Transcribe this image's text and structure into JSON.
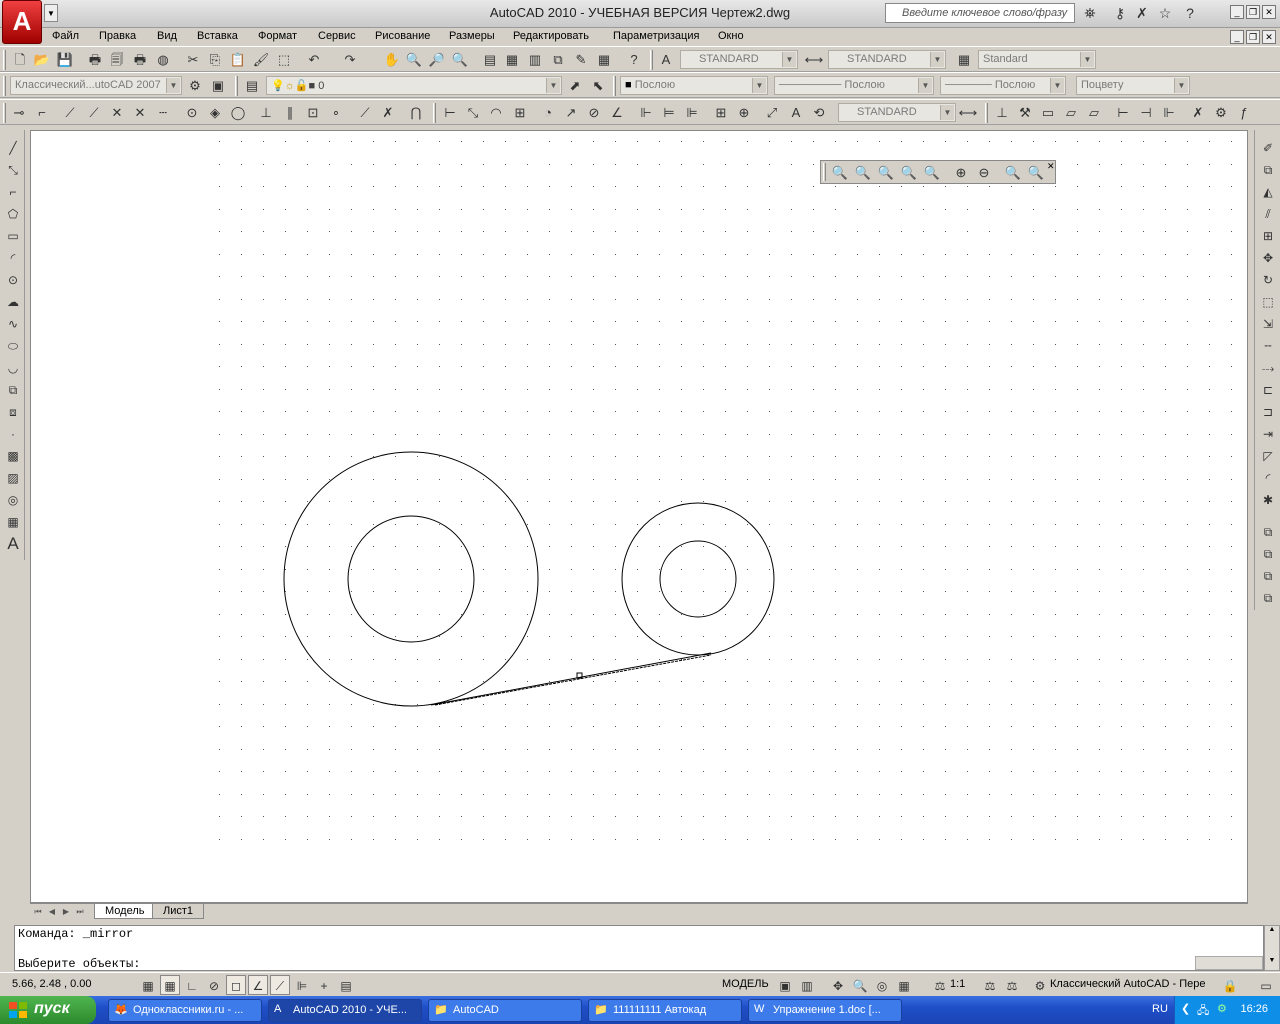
{
  "title_bar": {
    "title": "AutoCAD 2010 - УЧЕБНАЯ ВЕРСИЯ    Чертеж2.dwg",
    "search_placeholder": "Введите ключевое слово/фразу",
    "logo_text": "A"
  },
  "menu": [
    "Файл",
    "Правка",
    "Вид",
    "Вставка",
    "Формат",
    "Сервис",
    "Рисование",
    "Размеры",
    "Редактировать",
    "Параметризация",
    "Окно"
  ],
  "styles_toolbar": {
    "text_style": "STANDARD",
    "dim_style": "STANDARD",
    "table_style": "Standard"
  },
  "layers_toolbar": {
    "workspace": "Классический...utoCAD 2007",
    "layer": "0",
    "color": "Послою",
    "linetype": "Послою",
    "lineweight": "Послою",
    "plotstyle": "Поцвету"
  },
  "dim_toolbar": {
    "dim_style": "STANDARD"
  },
  "tabs": {
    "model": "Модель",
    "layout1": "Лист1"
  },
  "command": {
    "line1": "Команда: _mirror",
    "line2": "Выберите объекты:"
  },
  "status": {
    "coords": "5.66, 2.48 , 0.00",
    "model_label": "МОДЕЛЬ",
    "scale": "1:1",
    "workspace": "Классический AutoCAD - Пере"
  },
  "taskbar": {
    "start": "пуск",
    "items": [
      "Одноклассники.ru - ...",
      "AutoCAD 2010 - УЧЕ...",
      "AutoCAD",
      "111111111 Автокад",
      "Упражнение 1.doc [..."
    ],
    "lang": "RU",
    "time": "16:26"
  }
}
